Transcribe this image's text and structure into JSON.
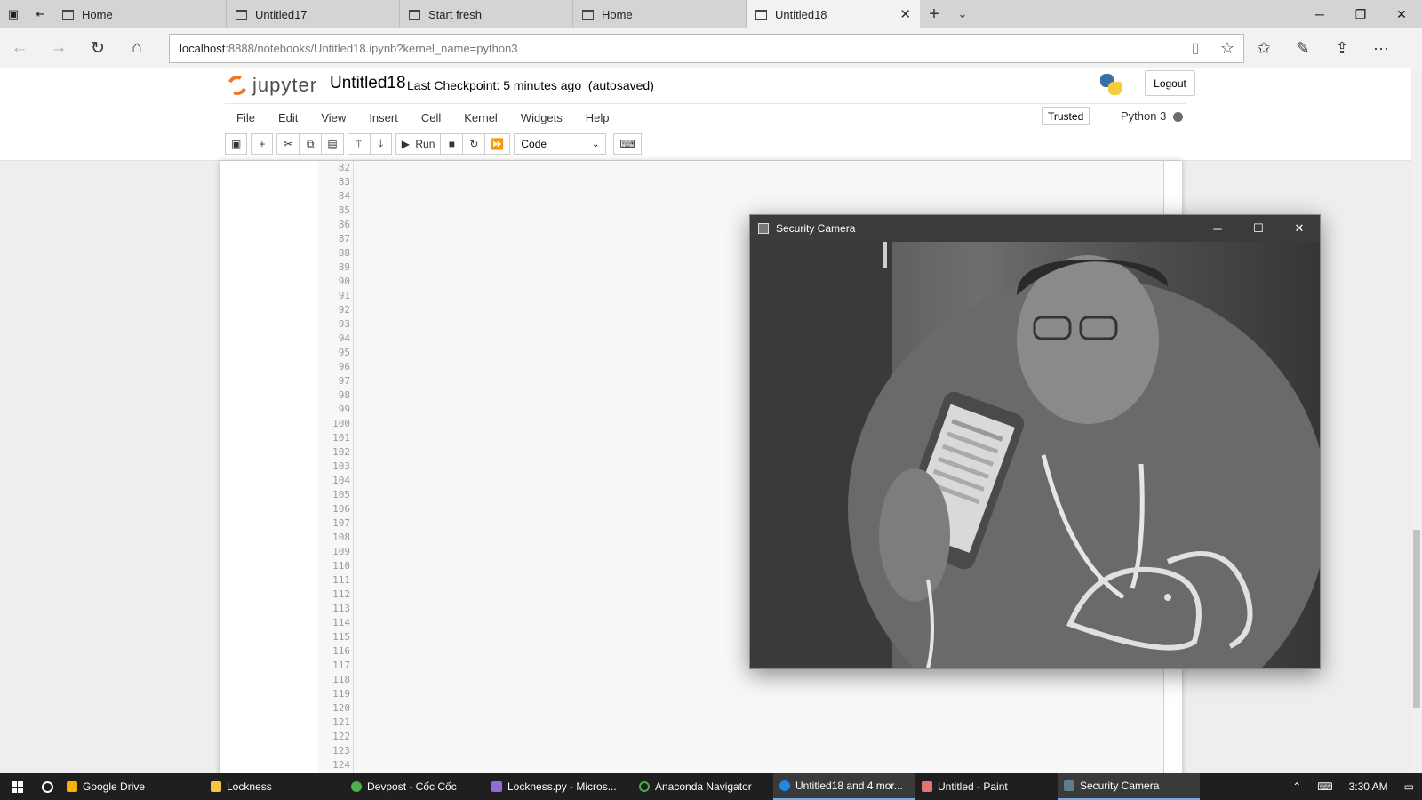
{
  "browser": {
    "tabs": [
      {
        "label": "Home"
      },
      {
        "label": "Untitled17"
      },
      {
        "label": "Start fresh"
      },
      {
        "label": "Home"
      },
      {
        "label": "Untitled18"
      }
    ],
    "url_host": "localhost",
    "url_rest": ":8888/notebooks/Untitled18.ipynb?kernel_name=python3"
  },
  "jupyter": {
    "logo_text": "jupyter",
    "notebook_name": "Untitled18",
    "checkpoint_label": "Last Checkpoint:",
    "checkpoint_time": "5 minutes ago",
    "autosave": "(autosaved)",
    "logout_label": "Logout",
    "menu": [
      "File",
      "Edit",
      "View",
      "Insert",
      "Cell",
      "Kernel",
      "Widgets",
      "Help"
    ],
    "trusted_label": "Trusted",
    "kernel_name": "Python 3",
    "run_label": "Run",
    "cell_type": "Code"
  },
  "code": {
    "line_numbers": [
      "82",
      "83",
      "84",
      "85",
      "86",
      "87",
      "88",
      "89",
      "90",
      "91",
      "92",
      "93",
      "94",
      "95",
      "96",
      "97",
      "98",
      "99",
      "100",
      "101",
      "102",
      "103",
      "104",
      "105",
      "106",
      "107",
      "108",
      "109",
      "110",
      "111",
      "112",
      "113",
      "114",
      "115",
      "116",
      "117",
      "118",
      "119",
      "120",
      "121",
      "122",
      "123",
      "124"
    ]
  },
  "camera_window": {
    "title": "Security Camera"
  },
  "taskbar": {
    "items": [
      {
        "label": "Google Drive",
        "color": "#f4b400"
      },
      {
        "label": "Lockness",
        "color": "#f5c542"
      },
      {
        "label": "Devpost - Cốc Cốc",
        "color": "#4caf50"
      },
      {
        "label": "Lockness.py - Micros...",
        "color": "#8e6bd8"
      },
      {
        "label": "Anaconda Navigator",
        "color": "#43b049"
      },
      {
        "label": "Untitled18 and 4 mor...",
        "color": "#1e88e5"
      },
      {
        "label": "Untitled - Paint",
        "color": "#e57373"
      },
      {
        "label": "Security Camera",
        "color": "#607d8b"
      }
    ],
    "time": "3:30 AM"
  }
}
